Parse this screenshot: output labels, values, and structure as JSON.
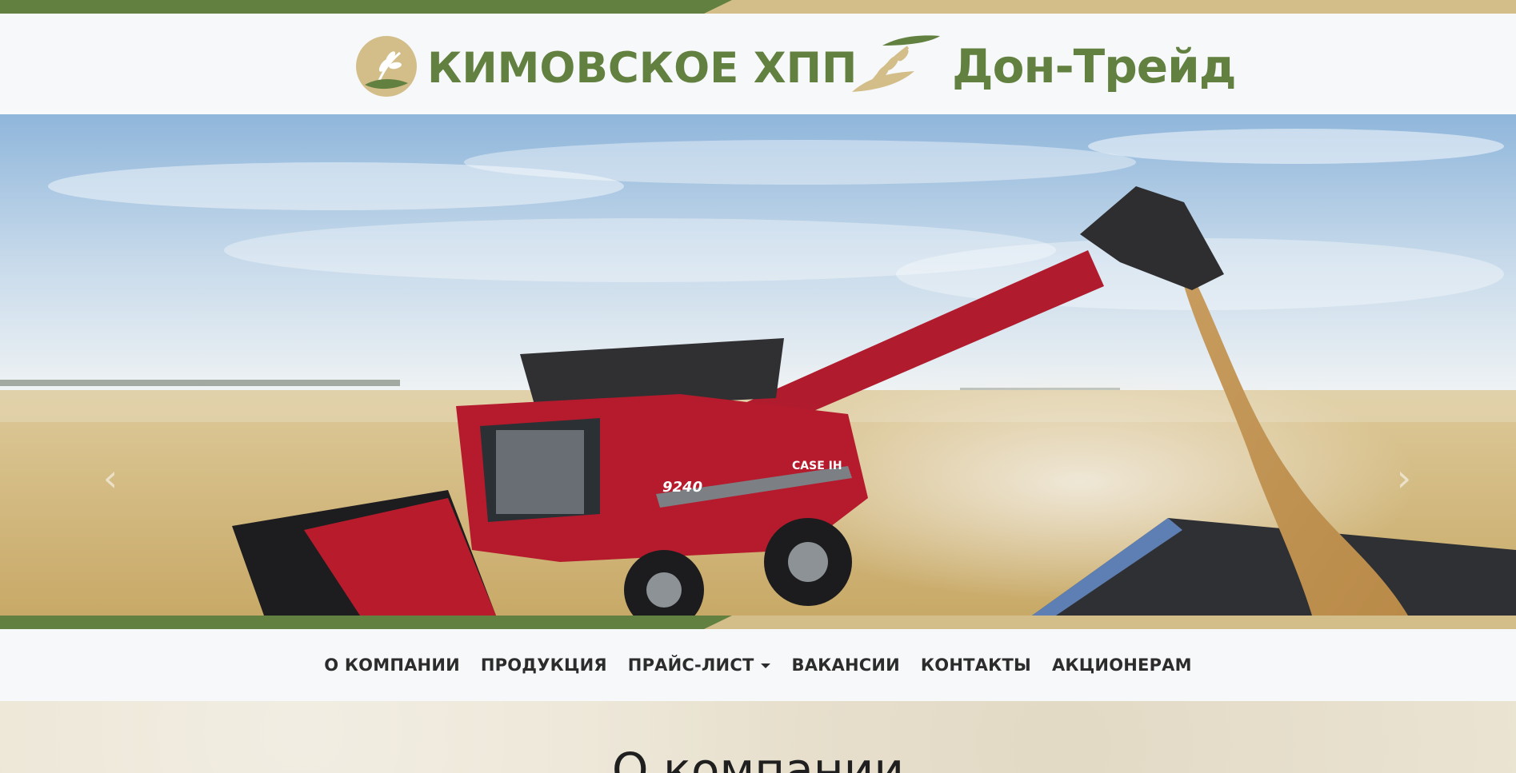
{
  "colors": {
    "brand_green": "#628140",
    "brand_sand": "#d3be8a",
    "nav_text": "#2c2c2c",
    "page_bg": "#f7f8fa"
  },
  "header": {
    "logo_left": {
      "text": "КИМОВСКОЕ ХПП",
      "icon": "wheat-circle-icon"
    },
    "logo_right": {
      "text": "Дон-Трейд",
      "icon": "wheat-leaf-icon"
    }
  },
  "hero": {
    "image": "combine-harvester-unloading-grain",
    "prev_icon": "chevron-left-icon",
    "next_icon": "chevron-right-icon",
    "prev_glyph": "‹",
    "next_glyph": "›",
    "combine_model": "9240",
    "combine_brand": "CASE IH"
  },
  "nav": {
    "items": [
      {
        "label": "О КОМПАНИИ"
      },
      {
        "label": "ПРОДУКЦИЯ"
      },
      {
        "label": "ПРАЙС-ЛИСТ",
        "dropdown": true
      },
      {
        "label": "ВАКАНСИИ"
      },
      {
        "label": "КОНТАКТЫ"
      },
      {
        "label": "АКЦИОНЕРАМ"
      }
    ]
  },
  "about": {
    "title": "О компании"
  }
}
